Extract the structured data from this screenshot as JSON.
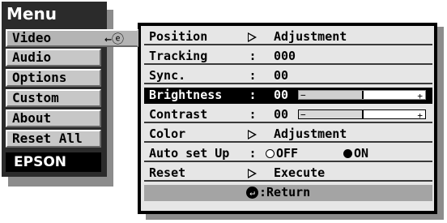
{
  "menu": {
    "title": "Menu",
    "items": [
      {
        "label": "Video",
        "active": true
      },
      {
        "label": "Audio"
      },
      {
        "label": "Options"
      },
      {
        "label": "Custom"
      },
      {
        "label": "About"
      },
      {
        "label": "Reset All"
      }
    ],
    "brand": "EPSON",
    "return_glyph": "←ⓔ"
  },
  "submenu": {
    "rows": [
      {
        "label": "Position",
        "sep": "▷",
        "value": "Adjustment"
      },
      {
        "label": "Tracking",
        "sep": ":",
        "value": "000"
      },
      {
        "label": "Sync.",
        "sep": ":",
        "value": "00"
      },
      {
        "label": "Brightness",
        "sep": ":",
        "value": "00",
        "selected": true,
        "bar_level_percent": 50,
        "bar_minus": "−",
        "bar_plus": "+"
      },
      {
        "label": "Contrast",
        "sep": ":",
        "value": "00",
        "bar_level_percent": 50,
        "bar_minus": "−",
        "bar_plus": "+"
      },
      {
        "label": "Color",
        "sep": "▷",
        "value": "Adjustment"
      },
      {
        "label": "Auto set Up",
        "sep": ":",
        "option_off": "OFF",
        "option_on": "ON",
        "selected_option": "ON"
      },
      {
        "label": "Reset",
        "sep": "▷",
        "value": "Execute"
      }
    ],
    "footer": {
      "icon": "↵",
      "label": ":Return"
    }
  },
  "colors": {
    "highlight": "#000000",
    "panel": "#e6e6e6",
    "button": "#c7c7c7",
    "footer": "#a4a4a4"
  }
}
